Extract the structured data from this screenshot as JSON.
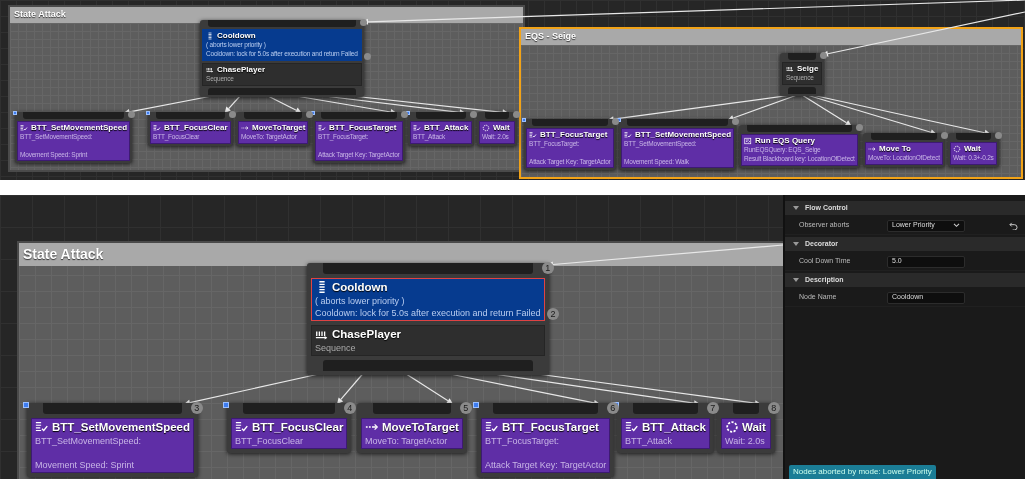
{
  "views": [
    {
      "groups": [
        {
          "title": "State Attack",
          "selected": false,
          "root": {
            "kind": "sequence",
            "title": "ChasePlayer",
            "subtitle": "Sequence",
            "decorators": [
              {
                "title": "Cooldown",
                "lines": [
                  "( aborts lower priority )",
                  "Cooldown: lock for 5.0s after execution and return Failed"
                ],
                "selected": false
              }
            ]
          },
          "children": [
            {
              "kind": "blueprint_task",
              "title": "BTT_SetMovementSpeed",
              "subtitle": "BTT_SetMovementSpeed:",
              "detail": "Movement Speed: Sprint"
            },
            {
              "kind": "blueprint_task",
              "title": "BTT_FocusClear",
              "subtitle": "BTT_FocusClear"
            },
            {
              "kind": "move_to",
              "title": "MoveToTarget",
              "subtitle": "MoveTo: TargetActor"
            },
            {
              "kind": "blueprint_task",
              "title": "BTT_FocusTarget",
              "subtitle": "BTT_FocusTarget:",
              "detail": "Attack Target Key: TargetActor"
            },
            {
              "kind": "blueprint_task",
              "title": "BTT_Attack",
              "subtitle": "BTT_Attack"
            },
            {
              "kind": "wait",
              "title": "Wait",
              "subtitle": "Wait: 2.0s"
            }
          ]
        },
        {
          "title": "EQS - Seige",
          "selected": true,
          "root": {
            "kind": "sequence",
            "title": "Seige",
            "subtitle": "Sequence"
          },
          "children": [
            {
              "kind": "blueprint_task",
              "title": "BTT_FocusTarget",
              "subtitle": "BTT_FocusTarget:",
              "detail": "Attack Target Key: TargetActor"
            },
            {
              "kind": "blueprint_task",
              "title": "BTT_SetMovementSpeed",
              "subtitle": "BTT_SetMovementSpeed:",
              "detail": "Movement Speed: Walk"
            },
            {
              "kind": "eqs_query",
              "title": "Run EQS Query",
              "subtitle": "RunEQSQuery: EQS_Seige",
              "detail": "Result Blackboard key: LocationOfDetect"
            },
            {
              "kind": "move_to",
              "title": "Move To",
              "subtitle": "MoveTo: LocationOfDetect"
            },
            {
              "kind": "wait",
              "title": "Wait",
              "subtitle": "Wait: 0.3+-0.2s"
            }
          ]
        }
      ]
    },
    {
      "groups": [
        {
          "title": "State Attack",
          "selected": false,
          "root": {
            "kind": "sequence",
            "title": "ChasePlayer",
            "subtitle": "Sequence",
            "pin": "1",
            "decorators": [
              {
                "title": "Cooldown",
                "lines": [
                  "( aborts lower priority )",
                  "Cooldown: lock for 5.0s after execution and return Failed"
                ],
                "selected": true,
                "pin": "2"
              }
            ]
          },
          "children": [
            {
              "kind": "blueprint_task",
              "title": "BTT_SetMovementSpeed",
              "subtitle": "BTT_SetMovementSpeed:",
              "detail": "Movement Speed: Sprint",
              "pin": "3"
            },
            {
              "kind": "blueprint_task",
              "title": "BTT_FocusClear",
              "subtitle": "BTT_FocusClear",
              "pin": "4"
            },
            {
              "kind": "move_to",
              "title": "MoveToTarget",
              "subtitle": "MoveTo: TargetActor",
              "pin": "5"
            },
            {
              "kind": "blueprint_task",
              "title": "BTT_FocusTarget",
              "subtitle": "BTT_FocusTarget:",
              "detail": "Attack Target Key: TargetActor",
              "pin": "6"
            },
            {
              "kind": "blueprint_task",
              "title": "BTT_Attack",
              "subtitle": "BTT_Attack",
              "pin": "7"
            },
            {
              "kind": "wait",
              "title": "Wait",
              "subtitle": "Wait: 2.0s",
              "pin": "8"
            }
          ]
        }
      ],
      "details": {
        "sections": [
          {
            "title": "Flow Control",
            "expanded": true,
            "rows": [
              {
                "label": "Observer aborts",
                "kind": "dropdown",
                "value": "Lower Priority",
                "resettable": true
              }
            ]
          },
          {
            "title": "Decorator",
            "expanded": true,
            "rows": [
              {
                "label": "Cool Down Time",
                "kind": "text",
                "value": "5.0",
                "resettable": false
              }
            ]
          },
          {
            "title": "Description",
            "expanded": true,
            "rows": [
              {
                "label": "Node Name",
                "kind": "text",
                "value": "Cooldown",
                "resettable": false
              }
            ]
          }
        ]
      },
      "tooltip": "Nodes aborted by mode: Lower Priority"
    }
  ]
}
